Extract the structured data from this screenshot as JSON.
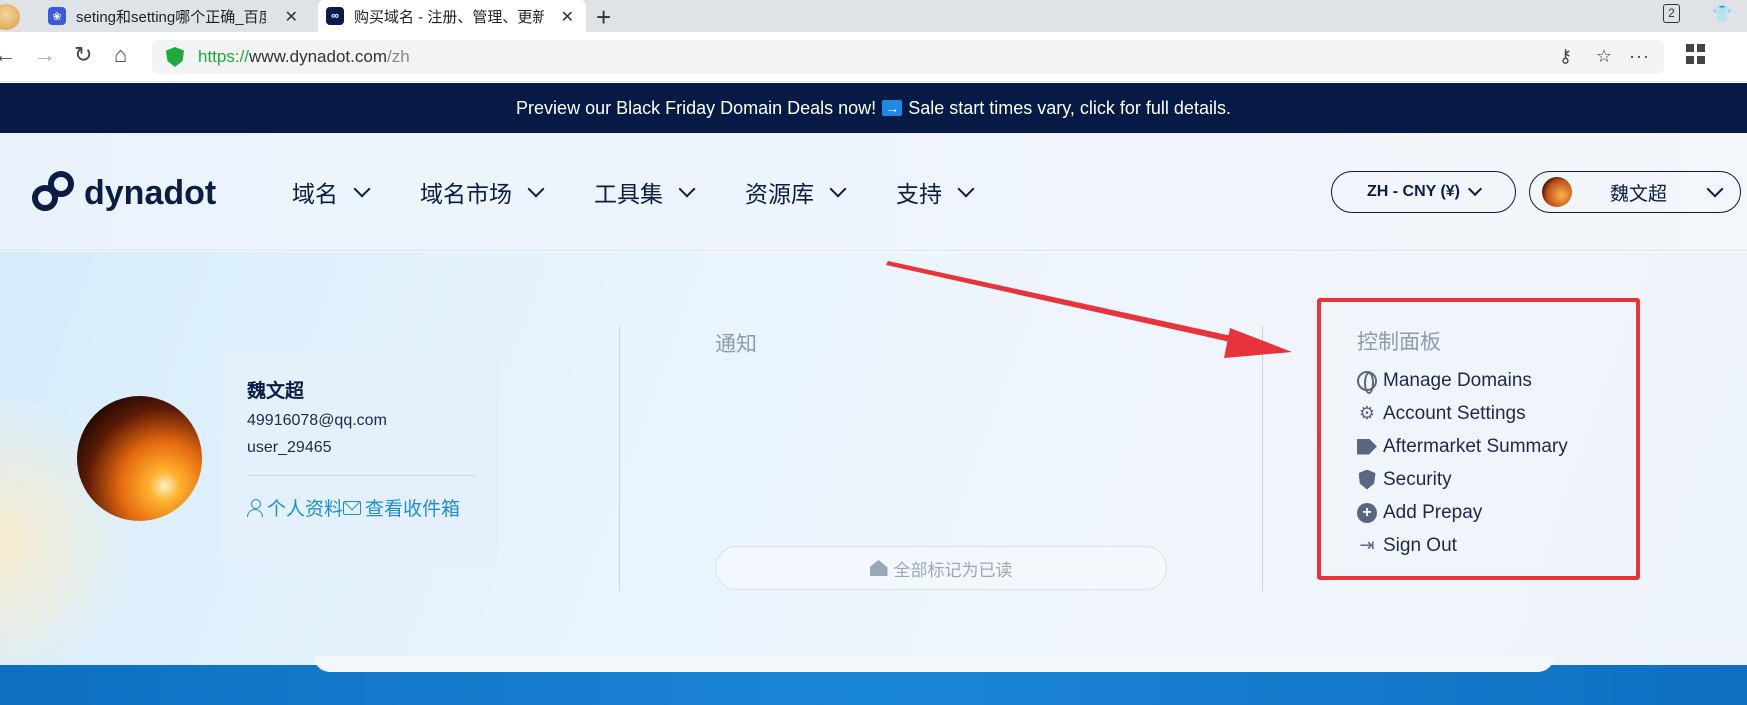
{
  "browser": {
    "tabs": [
      {
        "label": "seting和setting哪个正确_百度",
        "icon": "baidu-paw-icon"
      },
      {
        "label": "购买域名 - 注册、管理、更新",
        "icon": "dynadot-logo-icon"
      }
    ],
    "new_tab": "+",
    "window_count": "2",
    "url": {
      "scheme": "https://",
      "host": "www.dynadot.com",
      "path": "/zh"
    }
  },
  "promo": {
    "text_before": "Preview our Black Friday Domain Deals now!",
    "arrow": "→",
    "text_after": "Sale start times vary, click for full details."
  },
  "header": {
    "logo_text": "dynadot",
    "nav": [
      "域名",
      "域名市场",
      "工具集",
      "资源库",
      "支持"
    ],
    "lang_selector": "ZH - CNY (¥)",
    "user_name": "魏文超"
  },
  "profile": {
    "name": "魏文超",
    "email": "49916078@qq.com",
    "username": "user_29465",
    "profile_link": "个人资料",
    "inbox_link": "查看收件箱"
  },
  "notifications": {
    "title": "通知",
    "mark_all_read": "全部标记为已读"
  },
  "control_panel": {
    "title": "控制面板",
    "items": [
      {
        "label": "Manage Domains",
        "icon": "globe-icon"
      },
      {
        "label": "Account Settings",
        "icon": "gear-icon"
      },
      {
        "label": "Aftermarket Summary",
        "icon": "tags-icon"
      },
      {
        "label": "Security",
        "icon": "shield-icon"
      },
      {
        "label": "Add Prepay",
        "icon": "plus-circle-icon"
      },
      {
        "label": "Sign Out",
        "icon": "sign-out-icon"
      }
    ]
  },
  "colors": {
    "brand_navy": "#0b1d45",
    "promo_bg": "#061a45",
    "link_blue": "#1c8fd4",
    "highlight_red": "#e8333b",
    "secure_green": "#1faa3c"
  }
}
